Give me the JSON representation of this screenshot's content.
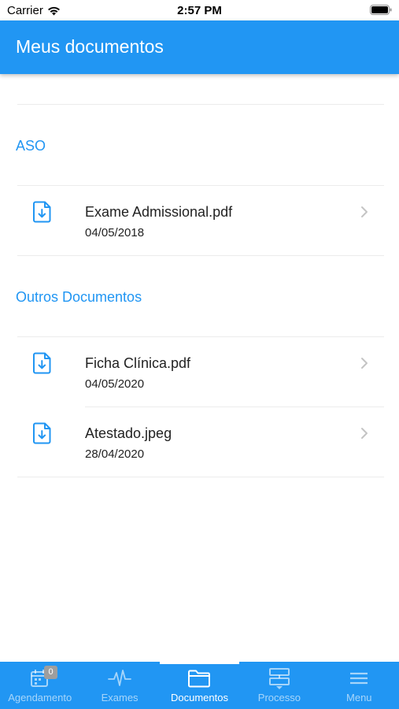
{
  "status_bar": {
    "carrier": "Carrier",
    "time": "2:57 PM"
  },
  "header": {
    "title": "Meus documentos"
  },
  "sections": [
    {
      "title": "ASO",
      "documents": [
        {
          "name": "Exame Admissional.pdf",
          "date": "04/05/2018",
          "icon": "file-download-icon"
        }
      ]
    },
    {
      "title": "Outros Documentos",
      "documents": [
        {
          "name": "Ficha Clínica.pdf",
          "date": "04/05/2020",
          "icon": "file-download-icon"
        },
        {
          "name": "Atestado.jpeg",
          "date": "28/04/2020",
          "icon": "file-download-icon"
        }
      ]
    }
  ],
  "tab_bar": {
    "tabs": [
      {
        "label": "Agendamento",
        "icon": "calendar-icon",
        "badge": "0"
      },
      {
        "label": "Exames",
        "icon": "heartbeat-icon"
      },
      {
        "label": "Documentos",
        "icon": "folder-icon",
        "active": true
      },
      {
        "label": "Processo",
        "icon": "process-icon"
      },
      {
        "label": "Menu",
        "icon": "hamburger-menu-icon"
      }
    ]
  },
  "colors": {
    "primary": "#2196f3",
    "text": "#222222",
    "divider": "#ececec"
  }
}
